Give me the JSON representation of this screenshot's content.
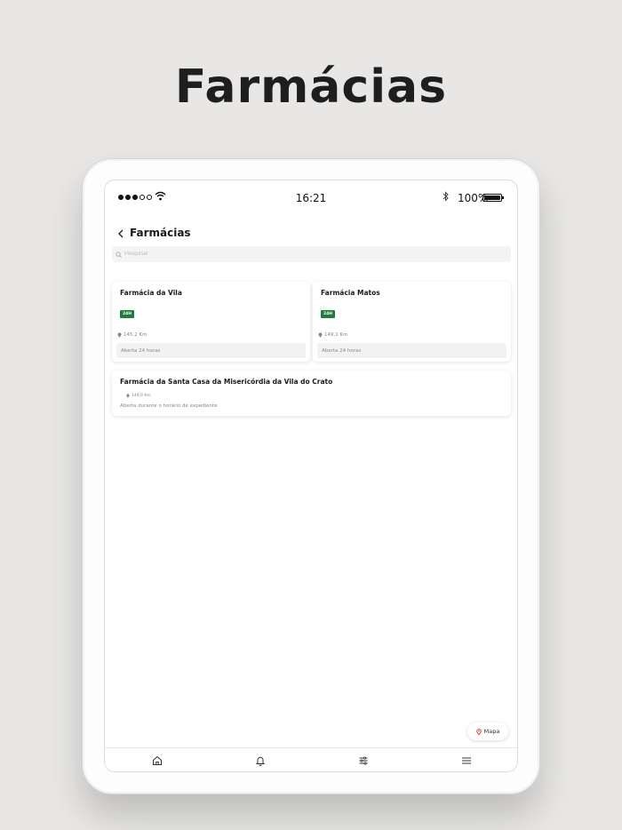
{
  "headline": "Farmácias",
  "status_bar": {
    "time": "16:21",
    "battery_percent": "100%",
    "signal_bars_filled": 3,
    "signal_bars_total": 5
  },
  "nav": {
    "title": "Farmácias",
    "back_icon": "chevron-left-icon"
  },
  "search": {
    "placeholder": "Pesquisar",
    "icon": "search-icon"
  },
  "cards": [
    {
      "name": "Farmácia da Vila",
      "badge": "24H",
      "distance": "145,2 Km",
      "hours": "Aberta 24 horas"
    },
    {
      "name": "Farmácia Matos",
      "badge": "24H",
      "distance": "149,1 Km",
      "hours": "Aberta 24 horas"
    },
    {
      "name": "Farmácia da Santa Casa da Misericórdia da Vila do Crato",
      "distance": "149,9 Km",
      "hours": "Aberta durante o horário de expediente"
    }
  ],
  "map_button": {
    "label": "Mapa",
    "icon": "location-pin-icon"
  },
  "tabbar": [
    {
      "icon": "home-icon"
    },
    {
      "icon": "bell-icon"
    },
    {
      "icon": "sliders-icon"
    },
    {
      "icon": "menu-icon"
    }
  ],
  "colors": {
    "badge": "#1e7d3a",
    "pin_accent": "#d9363e",
    "background": "#e8e7e5"
  }
}
